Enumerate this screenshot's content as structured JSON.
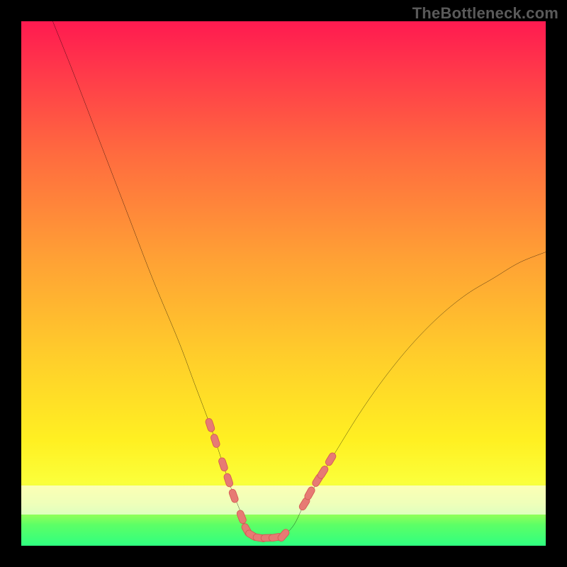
{
  "attribution": "TheBottleneck.com",
  "colors": {
    "page_bg": "#000000",
    "gradient_top": "#ff1a50",
    "gradient_mid": "#ffd02a",
    "gradient_bottom": "#2fff80",
    "curve_stroke": "#000000",
    "marker_fill": "#e77a74",
    "marker_stroke": "#d45a54",
    "attribution_text": "#5a5a5a"
  },
  "chart_data": {
    "type": "line",
    "title": "",
    "xlabel": "",
    "ylabel": "",
    "xlim": [
      0,
      100
    ],
    "ylim": [
      0,
      100
    ],
    "grid": false,
    "legend": false,
    "note": "U-shaped bottleneck curve. x is an unlabeled hardware-balance axis (0–100, left→right); y is bottleneck percentage (0–100, inverted: 0 at bottom = no bottleneck, 100 at top). Curve starts near (6,100), drops steeply to a flat trough of ~1–2 between x≈43 and x≈50, then rises more gently to ~(100,56). Salmon-pink markers highlight the segment entering and leaving the trough.",
    "series": [
      {
        "name": "bottleneck-curve",
        "x": [
          6,
          10,
          15,
          20,
          25,
          30,
          33,
          36,
          38,
          40,
          42,
          43,
          44,
          46,
          48,
          50,
          52,
          54,
          57,
          60,
          65,
          70,
          75,
          80,
          85,
          90,
          95,
          100
        ],
        "y": [
          100,
          90,
          77,
          64,
          51,
          39,
          31,
          23,
          17,
          11,
          6,
          3,
          2,
          1.5,
          1.5,
          2,
          4,
          8,
          13,
          18,
          26,
          33,
          39,
          44,
          48,
          51,
          54,
          56
        ]
      }
    ],
    "markers": {
      "name": "highlighted-range",
      "description": "Short pink capsule markers along the curve near the trough on both sides.",
      "points": [
        {
          "x": 36.0,
          "y": 23.0
        },
        {
          "x": 37.0,
          "y": 20.0
        },
        {
          "x": 38.5,
          "y": 15.5
        },
        {
          "x": 39.5,
          "y": 12.5
        },
        {
          "x": 40.5,
          "y": 9.5
        },
        {
          "x": 42.0,
          "y": 5.5
        },
        {
          "x": 43.0,
          "y": 3.0
        },
        {
          "x": 44.0,
          "y": 2.0
        },
        {
          "x": 45.5,
          "y": 1.5
        },
        {
          "x": 47.0,
          "y": 1.5
        },
        {
          "x": 48.5,
          "y": 1.6
        },
        {
          "x": 50.0,
          "y": 2.0
        },
        {
          "x": 54.0,
          "y": 8.0
        },
        {
          "x": 55.0,
          "y": 10.0
        },
        {
          "x": 56.5,
          "y": 12.5
        },
        {
          "x": 57.5,
          "y": 14.0
        },
        {
          "x": 59.0,
          "y": 16.5
        }
      ]
    }
  }
}
